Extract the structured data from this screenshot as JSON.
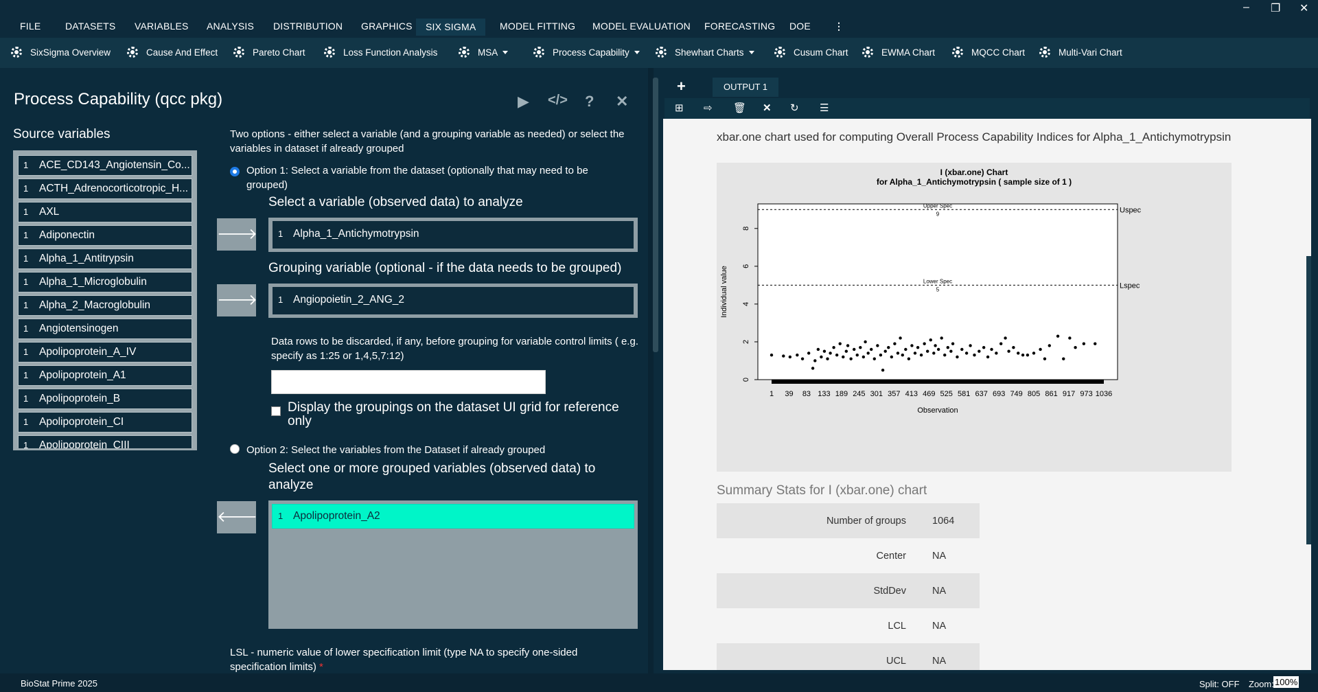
{
  "menu": {
    "items": [
      "FILE",
      "DATASETS",
      "VARIABLES",
      "ANALYSIS",
      "DISTRIBUTION",
      "GRAPHICS",
      "SIX SIGMA",
      "MODEL FITTING",
      "MODEL EVALUATION",
      "FORECASTING",
      "DOE"
    ],
    "more_icon": "⋮",
    "active": "SIX SIGMA"
  },
  "window_controls": {
    "minimize": "–",
    "maximize": "❐",
    "close": "✕"
  },
  "toolbar": {
    "items": [
      {
        "label": "SixSigma Overview",
        "dropdown": false
      },
      {
        "label": "Cause And Effect",
        "dropdown": false
      },
      {
        "label": "Pareto Chart",
        "dropdown": false
      },
      {
        "label": "Loss Function Analysis",
        "dropdown": false
      },
      {
        "label": "MSA",
        "dropdown": true
      },
      {
        "label": "Process Capability",
        "dropdown": true
      },
      {
        "label": "Shewhart Charts",
        "dropdown": true
      },
      {
        "label": "Cusum Chart",
        "dropdown": false
      },
      {
        "label": "EWMA Chart",
        "dropdown": false
      },
      {
        "label": "MQCC Chart",
        "dropdown": false
      },
      {
        "label": "Multi-Vari Chart",
        "dropdown": false
      }
    ]
  },
  "dialog": {
    "title": "Process Capability (qcc pkg)",
    "icons": {
      "run": "▶",
      "code": "</>",
      "help": "?",
      "close": "✕"
    },
    "source_label": "Source variables",
    "source_variables": [
      "ACE_CD143_Angiotensin_Co...",
      "ACTH_Adrenocorticotropic_H...",
      "AXL",
      "Adiponectin",
      "Alpha_1_Antitrypsin",
      "Alpha_1_Microglobulin",
      "Alpha_2_Macroglobulin",
      "Angiotensinogen",
      "Apolipoprotein_A_IV",
      "Apolipoprotein_A1",
      "Apolipoprotein_B",
      "Apolipoprotein_CI",
      "Apolipoprotein_CIII"
    ],
    "var_type_icon": "1 2 3",
    "intro": "Two options - either select a variable (and a grouping variable as needed) or select the variables in dataset if already grouped",
    "option1": "Option 1: Select a variable from the dataset (optionally that may need to be grouped)",
    "select_var_label": "Select a variable (observed data) to analyze",
    "selected_variable": "Alpha_1_Antichymotrypsin",
    "grouping_label": "Grouping variable (optional - if the data needs to be grouped)",
    "grouping_variable": "Angiopoietin_2_ANG_2",
    "discard_label": "Data rows to be discarded, if any, before grouping for variable control limits ( e.g. specify as 1:25 or 1,4,5,7:12)",
    "discard_value": "",
    "display_groupings_label": "Display the groupings on the dataset UI grid for reference only",
    "option2": "Option 2: Select the variables from the Dataset if already grouped",
    "grouped_label": "Select one or more grouped variables (observed data) to analyze",
    "grouped_variable": "Apolipoprotein_A2",
    "lsl_label": "LSL - numeric value of lower specification limit (type NA to specify one-sided specification limits)",
    "arrow_right": "🡒",
    "arrow_left": "🡐"
  },
  "output": {
    "plus": "+",
    "tab": "OUTPUT 1",
    "caption": "xbar.one chart used for computing Overall Process Capability Indices for Alpha_1_Antichymotrypsin",
    "stats_title": "Summary Stats for I (xbar.one) chart",
    "stats": [
      {
        "label": "Number of groups",
        "value": "1064"
      },
      {
        "label": "Center",
        "value": "NA"
      },
      {
        "label": "StdDev",
        "value": "NA"
      },
      {
        "label": "LCL",
        "value": "NA"
      },
      {
        "label": "UCL",
        "value": "NA"
      }
    ]
  },
  "chart_data": {
    "type": "scatter",
    "title": "I (xbar.one) Chart",
    "subtitle": "for Alpha_1_Antichymotrypsin ( sample size of 1 )",
    "xlabel": "Observation",
    "ylabel": "Individual value",
    "x_ticks": [
      "1",
      "39",
      "83",
      "133",
      "189",
      "245",
      "301",
      "357",
      "413",
      "469",
      "525",
      "581",
      "637",
      "693",
      "749",
      "805",
      "861",
      "917",
      "973",
      "1036"
    ],
    "y_ticks": [
      0,
      2,
      4,
      6,
      8
    ],
    "xlim": [
      1,
      1064
    ],
    "ylim": [
      0,
      9.3
    ],
    "reference_lines": [
      {
        "name": "Upper Spec",
        "value": 9,
        "side_label": "Uspec"
      },
      {
        "name": "Lower Spec",
        "value": 5,
        "side_label": "Lspec"
      }
    ],
    "series": [
      {
        "points": [
          [
            1,
            1.3
          ],
          [
            39,
            1.25
          ],
          [
            60,
            1.2
          ],
          [
            83,
            1.3
          ],
          [
            100,
            1.1
          ],
          [
            120,
            1.4
          ],
          [
            133,
            0.6
          ],
          [
            140,
            1.0
          ],
          [
            150,
            1.6
          ],
          [
            160,
            1.2
          ],
          [
            170,
            1.5
          ],
          [
            180,
            1.1
          ],
          [
            189,
            1.4
          ],
          [
            200,
            1.7
          ],
          [
            210,
            1.3
          ],
          [
            220,
            1.9
          ],
          [
            230,
            1.2
          ],
          [
            240,
            1.5
          ],
          [
            245,
            1.8
          ],
          [
            255,
            1.1
          ],
          [
            265,
            1.6
          ],
          [
            275,
            1.3
          ],
          [
            285,
            1.7
          ],
          [
            295,
            1.2
          ],
          [
            301,
            2.0
          ],
          [
            310,
            1.4
          ],
          [
            320,
            1.6
          ],
          [
            330,
            1.1
          ],
          [
            340,
            1.8
          ],
          [
            350,
            1.3
          ],
          [
            357,
            0.5
          ],
          [
            365,
            1.5
          ],
          [
            375,
            1.7
          ],
          [
            385,
            1.2
          ],
          [
            395,
            1.9
          ],
          [
            405,
            1.4
          ],
          [
            413,
            2.2
          ],
          [
            420,
            1.3
          ],
          [
            430,
            1.6
          ],
          [
            440,
            1.1
          ],
          [
            450,
            1.8
          ],
          [
            460,
            1.4
          ],
          [
            469,
            1.7
          ],
          [
            480,
            1.3
          ],
          [
            490,
            1.9
          ],
          [
            500,
            1.5
          ],
          [
            510,
            2.1
          ],
          [
            520,
            1.4
          ],
          [
            525,
            1.8
          ],
          [
            535,
            1.6
          ],
          [
            545,
            2.2
          ],
          [
            555,
            1.3
          ],
          [
            565,
            1.7
          ],
          [
            575,
            1.5
          ],
          [
            581,
            1.9
          ],
          [
            595,
            1.2
          ],
          [
            610,
            1.6
          ],
          [
            625,
            1.4
          ],
          [
            637,
            1.8
          ],
          [
            650,
            1.3
          ],
          [
            665,
            1.5
          ],
          [
            680,
            1.7
          ],
          [
            693,
            1.2
          ],
          [
            705,
            1.6
          ],
          [
            720,
            1.4
          ],
          [
            735,
            1.9
          ],
          [
            749,
            2.2
          ],
          [
            760,
            1.5
          ],
          [
            775,
            1.7
          ],
          [
            790,
            1.4
          ],
          [
            805,
            1.3
          ],
          [
            820,
            1.3
          ],
          [
            840,
            1.4
          ],
          [
            861,
            1.6
          ],
          [
            875,
            1.1
          ],
          [
            890,
            1.8
          ],
          [
            917,
            2.3
          ],
          [
            935,
            1.1
          ],
          [
            955,
            2.2
          ],
          [
            973,
            1.7
          ],
          [
            1000,
            1.9
          ],
          [
            1036,
            1.9
          ]
        ]
      }
    ]
  },
  "status": {
    "app": "BioStat Prime 2025",
    "split": "Split: OFF",
    "zoom_label": "Zoom:",
    "zoom": "100%"
  }
}
